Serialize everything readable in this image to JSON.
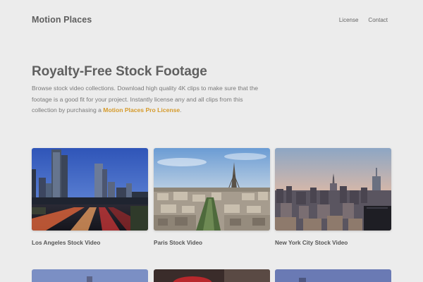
{
  "header": {
    "brand": "Motion Places",
    "nav": {
      "license": "License",
      "contact": "Contact"
    }
  },
  "hero": {
    "title": "Royalty-Free Stock Footage",
    "description": "Browse stock video collections. Download high quality 4K clips to make sure that the footage is a good fit for your project. Instantly license any and all clips from this collection by purchasing a ",
    "link_text": "Motion Places Pro License",
    "trailing": ".",
    "accent_color": "#d59a2a"
  },
  "collections": [
    {
      "title": "Los Angeles Stock Video"
    },
    {
      "title": "Paris Stock Video"
    },
    {
      "title": "New York City Stock Video"
    }
  ]
}
